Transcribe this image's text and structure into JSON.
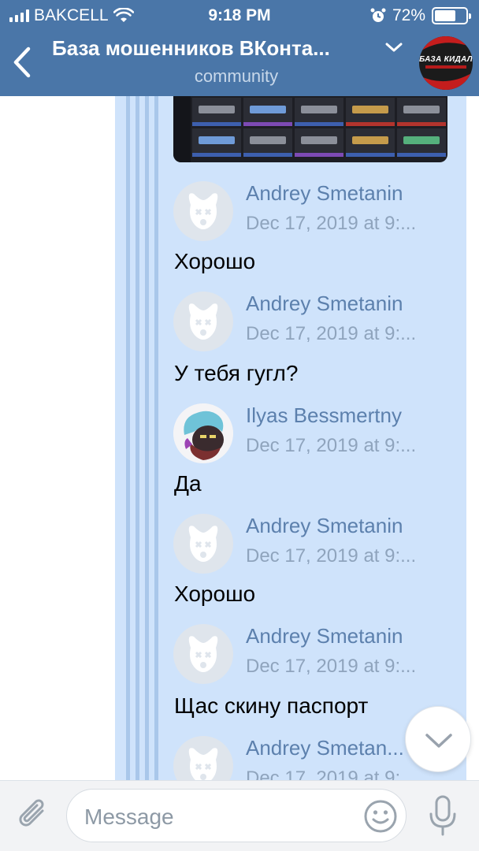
{
  "status_bar": {
    "carrier": "BAKCELL",
    "time": "9:18 PM",
    "battery": "72%",
    "battery_level": 0.72,
    "icons": [
      "signal-icon",
      "wifi-icon",
      "alarm-icon",
      "battery-icon"
    ]
  },
  "header": {
    "title": "База мошенников ВКонта...",
    "subtitle": "community",
    "avatar_text": "БАЗА КИДАЛ",
    "colors": {
      "bar": "#4a76a8",
      "subtitle": "#c8d8ea"
    }
  },
  "messages": [
    {
      "author": "Andrey Smetanin",
      "date": "Dec 17, 2019 at 9:...",
      "text": "Хорошо",
      "avatar": "deactivated-dog"
    },
    {
      "author": "Andrey Smetanin",
      "date": "Dec 17, 2019 at 9:...",
      "text": "У тебя гугл?",
      "avatar": "deactivated-dog"
    },
    {
      "author": "Ilyas Bessmertny",
      "date": "Dec 17, 2019 at 9:...",
      "text": "Да",
      "avatar": "user-photo"
    },
    {
      "author": "Andrey Smetanin",
      "date": "Dec 17, 2019 at 9:...",
      "text": "Хорошо",
      "avatar": "deactivated-dog"
    },
    {
      "author": "Andrey Smetanin",
      "date": "Dec 17, 2019 at 9:...",
      "text": "Щас скину паспорт",
      "avatar": "deactivated-dog"
    },
    {
      "author": "Andrey Smetan...",
      "date": "Dec 17, 2019 at 9:...",
      "text": "",
      "avatar": "deactivated-dog"
    }
  ],
  "composer": {
    "placeholder": "Message",
    "icons": [
      "paperclip-icon",
      "emoji-icon",
      "microphone-icon"
    ]
  },
  "colors": {
    "bubble": "#cfe3fb",
    "author": "#5c80ad",
    "date": "#8fa4bd",
    "forward_line": "#a9c7ea"
  }
}
